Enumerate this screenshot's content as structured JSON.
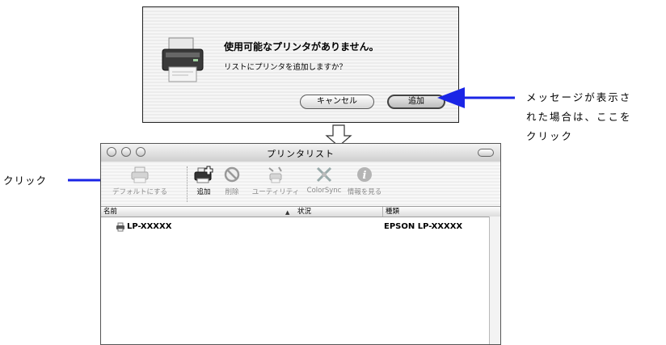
{
  "alert": {
    "title": "使用可能なプリンタがありません。",
    "message": "リストにプリンタを追加しますか？",
    "cancel_label": "キャンセル",
    "add_label": "追加"
  },
  "annotations": {
    "right_line1": "メッセージが表示さ",
    "right_line2": "れた場合は、ここを",
    "right_line3": "クリック",
    "left": "クリック"
  },
  "window": {
    "title": "プリンタリスト",
    "toolbar": [
      {
        "label": "デフォルトにする",
        "icon": "printer-default-icon",
        "enabled": false
      },
      {
        "label": "追加",
        "icon": "printer-add-icon",
        "enabled": true
      },
      {
        "label": "削除",
        "icon": "delete-icon",
        "enabled": false
      },
      {
        "label": "ユーティリティ",
        "icon": "utility-icon",
        "enabled": false
      },
      {
        "label": "ColorSync",
        "icon": "colorsync-icon",
        "enabled": false
      },
      {
        "label": "情報を見る",
        "icon": "info-icon",
        "enabled": false
      }
    ],
    "columns": [
      "名前",
      "状況",
      "種類"
    ],
    "rows": [
      {
        "name": "LP-XXXXX",
        "status": "",
        "kind": "EPSON LP-XXXXX"
      }
    ]
  },
  "colors": {
    "arrow": "#1a25e6",
    "text": "#000000"
  }
}
